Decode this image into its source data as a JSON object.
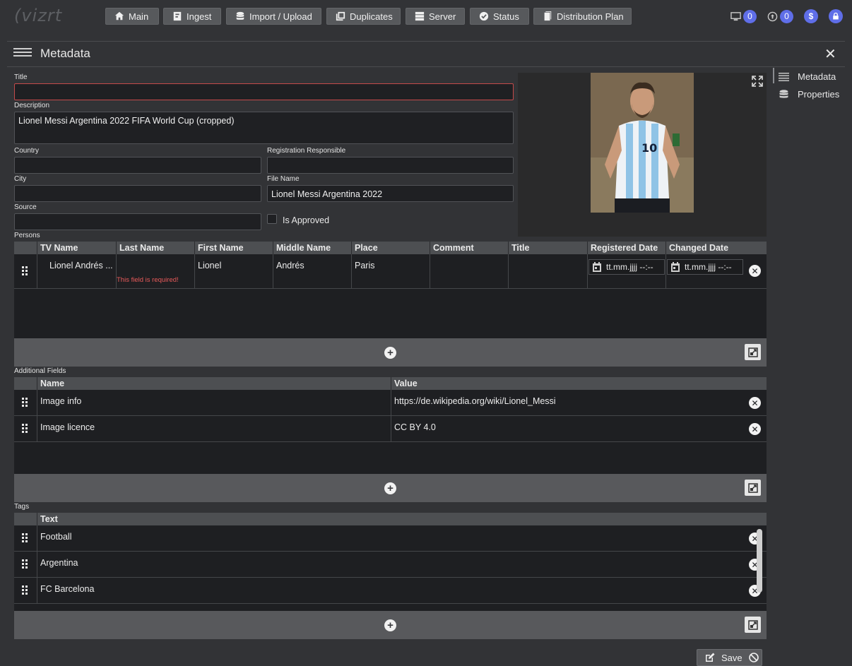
{
  "app": {
    "logo": "(vizrt"
  },
  "nav": {
    "main": "Main",
    "ingest": "Ingest",
    "import": "Import / Upload",
    "duplicates": "Duplicates",
    "server": "Server",
    "status": "Status",
    "distribution": "Distribution Plan"
  },
  "toolbar": {
    "monitor_count": "0",
    "upload_count": "0",
    "currency": "$"
  },
  "panel": {
    "title": "Metadata"
  },
  "form": {
    "title_label": "Title",
    "title_value": "",
    "description_label": "Description",
    "description_value": "Lionel Messi Argentina 2022 FIFA World Cup (cropped)",
    "country_label": "Country",
    "country_value": "",
    "registration_label": "Registration Responsible",
    "registration_value": "",
    "city_label": "City",
    "city_value": "",
    "filename_label": "File Name",
    "filename_value": "Lionel Messi Argentina 2022",
    "source_label": "Source",
    "source_value": "",
    "approved_label": "Is Approved"
  },
  "preview": {
    "player_number": "10"
  },
  "sidebar": {
    "items": [
      {
        "label": "Metadata"
      },
      {
        "label": "Properties"
      }
    ]
  },
  "persons": {
    "label": "Persons",
    "columns": [
      "TV Name",
      "Last Name",
      "First Name",
      "Middle Name",
      "Place",
      "Comment",
      "Title",
      "Registered Date",
      "Changed Date"
    ],
    "rows": [
      {
        "tv_name": "Lionel Andrés ...",
        "last_name": "",
        "required_msg": "This field is required!",
        "first_name": "Lionel",
        "middle_name": "Andrés",
        "place": "Paris",
        "comment": "",
        "title": "",
        "registered_date": "tt.mm.jjjj  --:--",
        "changed_date": "tt.mm.jjjj  --:--"
      }
    ]
  },
  "additional": {
    "label": "Additional Fields",
    "columns": [
      "Name",
      "Value"
    ],
    "rows": [
      {
        "name": "Image info",
        "value": "https://de.wikipedia.org/wiki/Lionel_Messi"
      },
      {
        "name": "Image licence",
        "value": "CC BY 4.0"
      }
    ]
  },
  "tags": {
    "label": "Tags",
    "columns": [
      "Text"
    ],
    "rows": [
      {
        "text": "Football"
      },
      {
        "text": "Argentina"
      },
      {
        "text": "FC Barcelona"
      }
    ]
  },
  "actions": {
    "save": "Save"
  }
}
